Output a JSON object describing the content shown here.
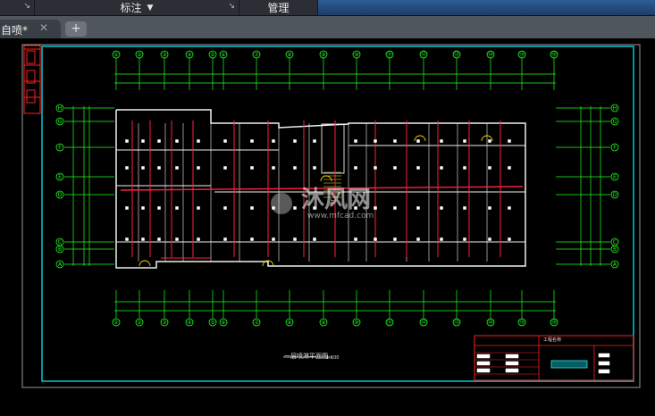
{
  "ribbon": {
    "annotate_label": "标注",
    "manage_label": "管理"
  },
  "tabs": {
    "document_title": "自喷*",
    "close_glyph": "✕",
    "new_tab_glyph": "+"
  },
  "drawing": {
    "axis_top_labels": [
      "①",
      "②",
      "③",
      "④",
      "⑤",
      "⑥",
      "⑦",
      "⑧",
      "⑨",
      "⑩",
      "⑪",
      "⑫",
      "⑬",
      "⑭",
      "⑮",
      "⑯"
    ],
    "axis_bottom_labels": [
      "①",
      "②",
      "③",
      "④",
      "⑤",
      "⑥",
      "⑦",
      "⑧",
      "⑨",
      "⑩",
      "⑪",
      "⑫",
      "⑬",
      "⑭",
      "⑮",
      "⑯"
    ],
    "axis_side_labels": [
      "H",
      "G",
      "F",
      "E",
      "D",
      "C",
      "B",
      "A"
    ],
    "title": "一层喷淋平面图",
    "scale": "1:100",
    "stair_up_label": "上",
    "title_block_heading": "工程名称",
    "watermark_text": "沐风网",
    "watermark_url": "www.mfcad.com"
  },
  "colors": {
    "drawing_border": "#00c8d8",
    "gridlines": "#20ff20",
    "walls": "#f0f0f0",
    "sprinkler_pipes": "#ff2040",
    "title_block": "#ff2020",
    "doors": "#ffd800"
  }
}
